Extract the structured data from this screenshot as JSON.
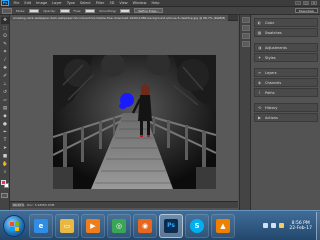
{
  "app": {
    "logo_text": "Ps"
  },
  "menu": [
    "File",
    "Edit",
    "Image",
    "Layer",
    "Type",
    "Select",
    "Filter",
    "3D",
    "View",
    "Window",
    "Help"
  ],
  "window_controls": {
    "minimize": "–",
    "maximize": "□",
    "close": "×"
  },
  "options_bar": {
    "mode_label": "Mode:",
    "opacity_label": "Opacity:",
    "flow_label": "Flow:",
    "smoothing_label": "Smoothing:",
    "refine_button": "Refine Edge...",
    "workspace": "Essentials"
  },
  "document": {
    "tab_title": "amazing-dark-wallpaper-dark-wallpaper-hd-colored-hd-mobile-free-download-1920x1080-background-iphone-5-desktop.jpg @ 66.7% (RGB/8)"
  },
  "tools": [
    {
      "icon": "move-tool-icon",
      "glyph": "✥"
    },
    {
      "icon": "marquee-tool-icon",
      "glyph": "⬚"
    },
    {
      "icon": "lasso-tool-icon",
      "glyph": "ʘ"
    },
    {
      "icon": "quick-select-tool-icon",
      "glyph": "✎"
    },
    {
      "icon": "crop-tool-icon",
      "glyph": "⌗"
    },
    {
      "icon": "eyedropper-tool-icon",
      "glyph": "⁄"
    },
    {
      "icon": "healing-brush-tool-icon",
      "glyph": "✚"
    },
    {
      "icon": "brush-tool-icon",
      "glyph": "✐"
    },
    {
      "icon": "clone-stamp-tool-icon",
      "glyph": "⊥"
    },
    {
      "icon": "history-brush-tool-icon",
      "glyph": "↺"
    },
    {
      "icon": "eraser-tool-icon",
      "glyph": "▱"
    },
    {
      "icon": "gradient-tool-icon",
      "glyph": "▤"
    },
    {
      "icon": "blur-tool-icon",
      "glyph": "◆"
    },
    {
      "icon": "dodge-tool-icon",
      "glyph": "●"
    },
    {
      "icon": "pen-tool-icon",
      "glyph": "✒"
    },
    {
      "icon": "type-tool-icon",
      "glyph": "T"
    },
    {
      "icon": "path-selection-tool-icon",
      "glyph": "➤"
    },
    {
      "icon": "shape-tool-icon",
      "glyph": "■"
    },
    {
      "icon": "hand-tool-icon",
      "glyph": "✋"
    },
    {
      "icon": "zoom-tool-icon",
      "glyph": "⌕"
    }
  ],
  "colors": {
    "foreground": "#e0336a",
    "background": "#ffffff",
    "brush_blue": "#1a1aff",
    "accent": "#31a8ff"
  },
  "status": {
    "zoom": "66.67%",
    "doc_info": "Doc: 5.93M/5.93M"
  },
  "panels": [
    {
      "icon": "color-icon",
      "glyph": "◐",
      "label": "Color"
    },
    {
      "icon": "swatches-icon",
      "glyph": "▦",
      "label": "Swatches"
    },
    {
      "icon": "adjustments-icon",
      "glyph": "◑",
      "label": "Adjustments"
    },
    {
      "icon": "styles-icon",
      "glyph": "✦",
      "label": "Styles"
    },
    {
      "icon": "layers-icon",
      "glyph": "≡",
      "label": "Layers"
    },
    {
      "icon": "channels-icon",
      "glyph": "◈",
      "label": "Channels"
    },
    {
      "icon": "paths-icon",
      "glyph": "⌇",
      "label": "Paths"
    },
    {
      "icon": "history-icon",
      "glyph": "⟲",
      "label": "History"
    },
    {
      "icon": "actions-icon",
      "glyph": "▶",
      "label": "Actions"
    }
  ],
  "taskbar": {
    "apps": [
      {
        "icon": "ie-icon",
        "glyph": "e",
        "color": "#2f8de4"
      },
      {
        "icon": "explorer-icon",
        "glyph": "▭",
        "color": "#e8b845"
      },
      {
        "icon": "media-player-icon",
        "glyph": "▶",
        "color": "#f07d1c"
      },
      {
        "icon": "chrome-icon",
        "glyph": "◎",
        "color": "#3aa655"
      },
      {
        "icon": "firefox-icon",
        "glyph": "◉",
        "color": "#e8661d"
      },
      {
        "icon": "photoshop-icon",
        "glyph": "Ps",
        "color": "#0c2c4e"
      },
      {
        "icon": "skype-icon",
        "glyph": "S",
        "color": "#00aff0"
      },
      {
        "icon": "vlc-icon",
        "glyph": "▲",
        "color": "#ee7f00"
      }
    ],
    "clock_time": "8:56 PM",
    "clock_date": "22-Feb-17"
  }
}
